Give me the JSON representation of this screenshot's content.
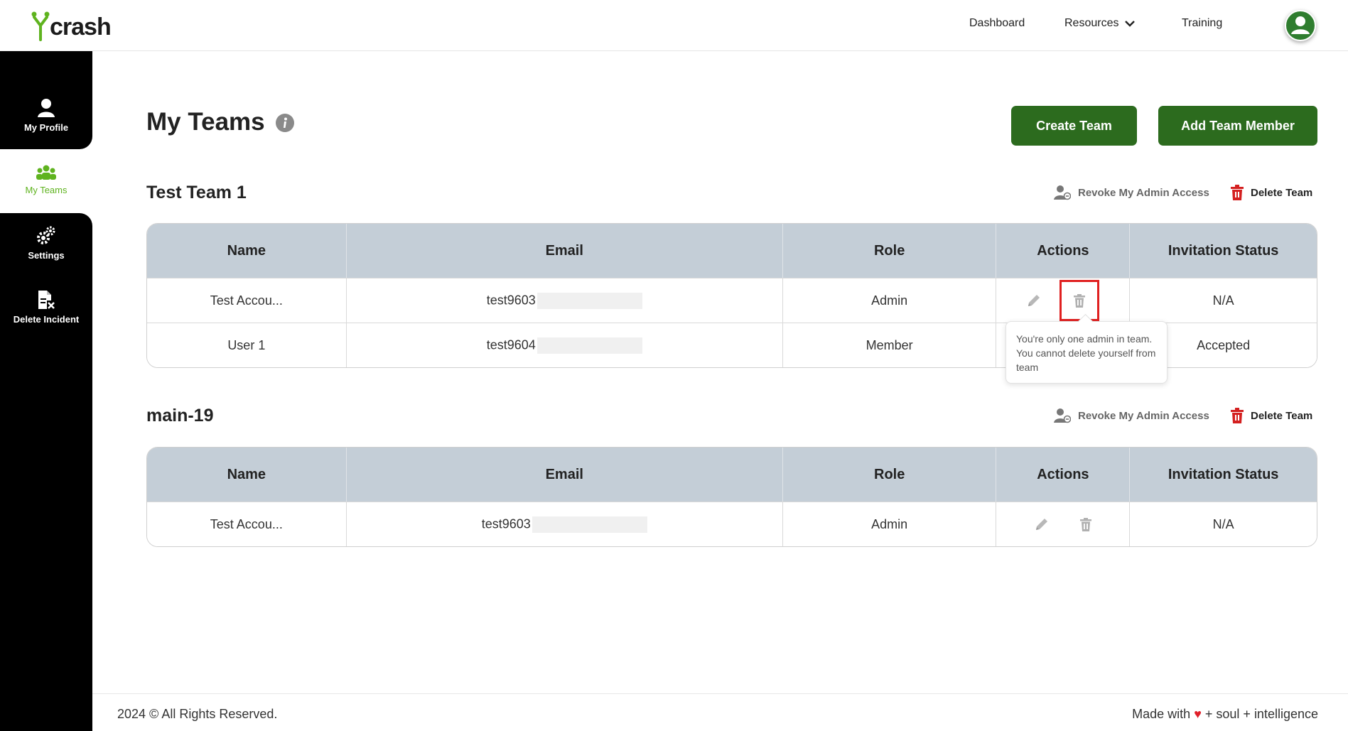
{
  "header": {
    "logo_text": "crash",
    "nav": {
      "dashboard": "Dashboard",
      "resources": "Resources",
      "training": "Training"
    }
  },
  "sidebar": {
    "items": [
      {
        "label": "My Profile",
        "icon": "user-icon"
      },
      {
        "label": "My Teams",
        "icon": "team-icon",
        "active": true
      },
      {
        "label": "Settings",
        "icon": "gears-icon"
      },
      {
        "label": "Delete Incident",
        "icon": "delete-file-icon"
      }
    ]
  },
  "main": {
    "title": "My Teams",
    "create_team_label": "Create Team",
    "add_member_label": "Add Team Member",
    "revoke_label": "Revoke My Admin Access",
    "delete_team_label": "Delete Team",
    "columns": [
      "Name",
      "Email",
      "Role",
      "Actions",
      "Invitation Status"
    ],
    "teams": [
      {
        "name": "Test Team 1",
        "members": [
          {
            "name": "Test Accou...",
            "email": "test9603",
            "role": "Admin",
            "status": "N/A"
          },
          {
            "name": "User 1",
            "email": "test9604",
            "role": "Member",
            "status": "Accepted"
          }
        ]
      },
      {
        "name": "main-19",
        "members": [
          {
            "name": "Test Accou...",
            "email": "test9603",
            "role": "Admin",
            "status": "N/A"
          }
        ]
      }
    ],
    "tooltip": "You're only one admin in team. You cannot delete yourself from team"
  },
  "footer": {
    "copyright": "2024 © All Rights Reserved.",
    "made_with": "Made with",
    "heart": "♥",
    "tagline": "+ soul + intelligence"
  },
  "colors": {
    "brand_green": "#2c6b1e",
    "accent_green": "#5fb31f",
    "table_header": "#c4ced7",
    "delete_red": "#d42020"
  }
}
